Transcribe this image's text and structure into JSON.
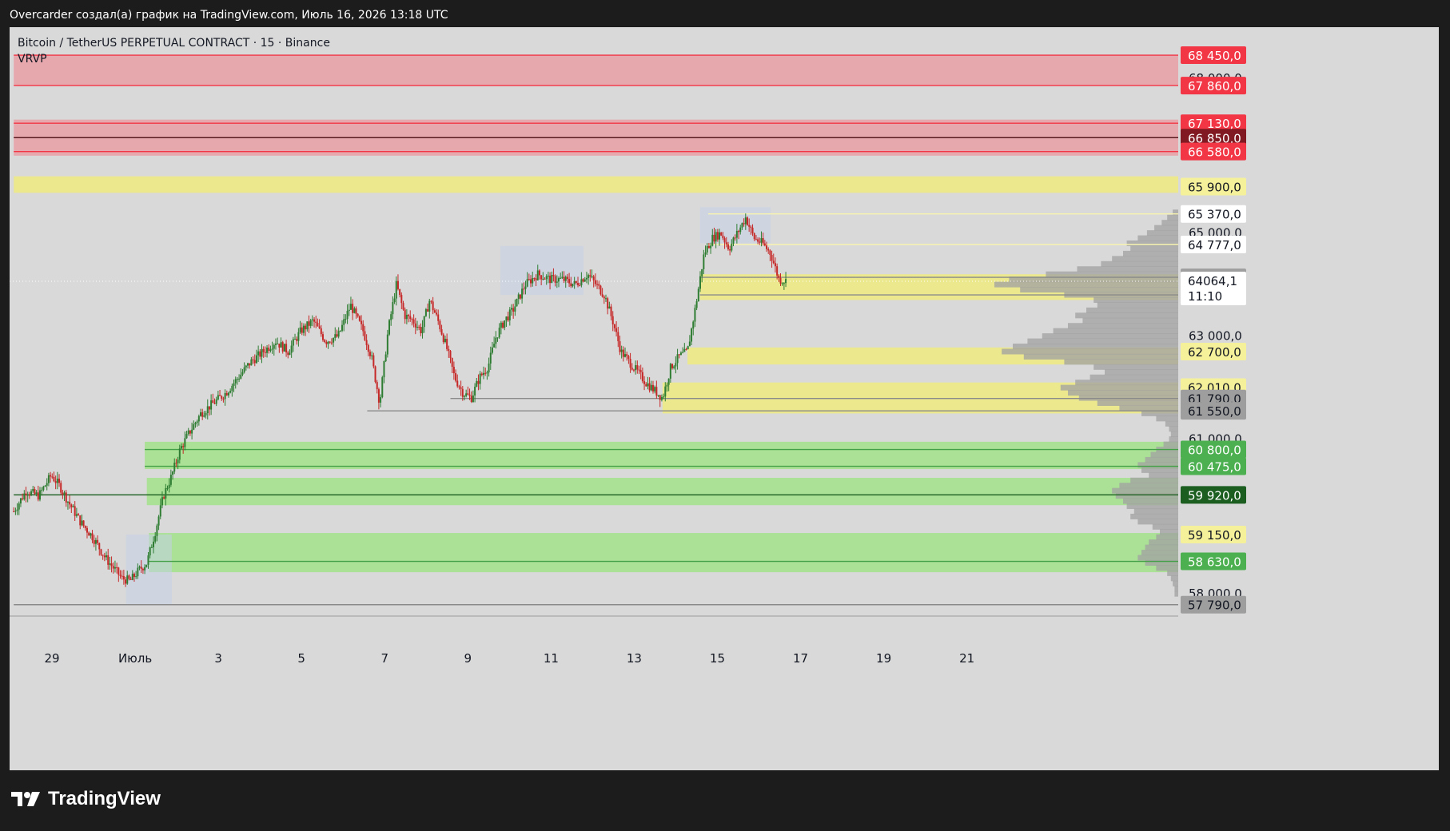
{
  "header": {
    "text": "Overcarder создал(а) график на TradingView.com, Июль 16, 2026 13:18 UTC"
  },
  "brand": {
    "name": "TradingView",
    "icon": "tradingview-logo-icon"
  },
  "chart_data": {
    "type": "candlestick",
    "title": "Bitcoin / TetherUS PERPETUAL CONTRACT · 15 · Binance",
    "indicator": "VRVP",
    "current_price": "64064,1",
    "countdown": "11:10",
    "ylim": [
      57600,
      68900
    ],
    "x_ticks": [
      {
        "label": "29",
        "day": -1
      },
      {
        "label": "Июль",
        "day": 1
      },
      {
        "label": "3",
        "day": 3
      },
      {
        "label": "5",
        "day": 5
      },
      {
        "label": "7",
        "day": 7
      },
      {
        "label": "9",
        "day": 9
      },
      {
        "label": "11",
        "day": 11
      },
      {
        "label": "13",
        "day": 13
      },
      {
        "label": "15",
        "day": 15
      },
      {
        "label": "17",
        "day": 17
      },
      {
        "label": "19",
        "day": 19
      },
      {
        "label": "21",
        "day": 21
      }
    ],
    "y_ticks": [
      {
        "label": "68 000,0",
        "value": 68000
      },
      {
        "label": "65 000,0",
        "value": 65000
      },
      {
        "label": "63 000,0",
        "value": 63000
      },
      {
        "label": "61 000,0",
        "value": 61000
      },
      {
        "label": "58 000,0",
        "value": 58000
      }
    ],
    "price_labels": [
      {
        "label": "68 450,0",
        "value": 68450,
        "bg": "#f23645",
        "fg": "#ffffff"
      },
      {
        "label": "67 860,0",
        "value": 67860,
        "bg": "#f23645",
        "fg": "#ffffff"
      },
      {
        "label": "67 130,0",
        "value": 67130,
        "bg": "#f23645",
        "fg": "#ffffff"
      },
      {
        "label": "66 850,0",
        "value": 66850,
        "bg": "#801922",
        "fg": "#ffffff"
      },
      {
        "label": "66 580,0",
        "value": 66580,
        "bg": "#f23645",
        "fg": "#ffffff"
      },
      {
        "label": "65 900,0",
        "value": 65900,
        "bg": "#f5f19a",
        "fg": "#131722"
      },
      {
        "label": "65 370,0",
        "value": 65370,
        "bg": "#ffffff",
        "fg": "#131722"
      },
      {
        "label": "64 777,0",
        "value": 64777,
        "bg": "#ffffff",
        "fg": "#131722"
      },
      {
        "label": "64 140,0",
        "value": 64140,
        "bg": "#9e9e9e",
        "fg": "#131722"
      },
      {
        "label": "63 800,0",
        "value": 63800,
        "bg": "#9e9e9e",
        "fg": "#131722"
      },
      {
        "label": "62 700,0",
        "value": 62700,
        "bg": "#f5f19a",
        "fg": "#131722"
      },
      {
        "label": "62 010,0",
        "value": 62010,
        "bg": "#f5f19a",
        "fg": "#131722"
      },
      {
        "label": "61 790,0",
        "value": 61790,
        "bg": "#9e9e9e",
        "fg": "#131722"
      },
      {
        "label": "61 550,0",
        "value": 61550,
        "bg": "#9e9e9e",
        "fg": "#131722"
      },
      {
        "label": "60 800,0",
        "value": 60800,
        "bg": "#4caf50",
        "fg": "#ffffff"
      },
      {
        "label": "60 475,0",
        "value": 60475,
        "bg": "#4caf50",
        "fg": "#ffffff"
      },
      {
        "label": "59 920,0",
        "value": 59920,
        "bg": "#1b5e20",
        "fg": "#ffffff"
      },
      {
        "label": "59 150,0",
        "value": 59150,
        "bg": "#f5f19a",
        "fg": "#131722"
      },
      {
        "label": "58 630,0",
        "value": 58630,
        "bg": "#4caf50",
        "fg": "#ffffff"
      },
      {
        "label": "57 790,0",
        "value": 57790,
        "bg": "#9e9e9e",
        "fg": "#131722"
      }
    ],
    "zones": [
      {
        "from": 67860,
        "to": 68450,
        "fill": "#e8a5ab",
        "start_day": -1.9
      },
      {
        "from": 66500,
        "to": 67200,
        "fill": "#e8a5ab",
        "start_day": -1.9
      },
      {
        "from": 65780,
        "to": 66100,
        "fill": "#ece98a",
        "start_day": -1.9
      },
      {
        "from": 63700,
        "to": 64200,
        "fill": "#ece98a",
        "start_day": 14.6
      },
      {
        "from": 62450,
        "to": 62780,
        "fill": "#ece98a",
        "start_day": 14.3
      },
      {
        "from": 61500,
        "to": 62100,
        "fill": "#ece98a",
        "start_day": 13.7
      },
      {
        "from": 60420,
        "to": 60950,
        "fill": "#a8e292",
        "start_day": 1.25
      },
      {
        "from": 59720,
        "to": 60250,
        "fill": "#a8e292",
        "start_day": 1.3
      },
      {
        "from": 58420,
        "to": 59180,
        "fill": "#a8e292",
        "start_day": 1.35
      }
    ],
    "h_lines": [
      {
        "value": 68450,
        "color": "#f23645",
        "start_day": -1.9
      },
      {
        "value": 67860,
        "color": "#f23645",
        "start_day": -1.9
      },
      {
        "value": 67130,
        "color": "#f23645",
        "start_day": -1.9
      },
      {
        "value": 66850,
        "color": "#5a1a1f",
        "start_day": -1.9
      },
      {
        "value": 66580,
        "color": "#f23645",
        "start_day": -1.9
      },
      {
        "value": 65370,
        "color": "#f8f4b0",
        "start_day": 14.8
      },
      {
        "value": 64777,
        "color": "#f8f4b0",
        "start_day": 14.8
      },
      {
        "value": 64140,
        "color": "#8a8a8a",
        "start_day": 14.6
      },
      {
        "value": 63800,
        "color": "#8a8a8a",
        "start_day": 14.6
      },
      {
        "value": 61790,
        "color": "#8a8a8a",
        "start_day": 8.6
      },
      {
        "value": 61550,
        "color": "#8a8a8a",
        "start_day": 6.6
      },
      {
        "value": 60800,
        "color": "#43a047",
        "start_day": 1.25
      },
      {
        "value": 60475,
        "color": "#43a047",
        "start_day": 1.25
      },
      {
        "value": 59920,
        "color": "#1b5e20",
        "start_day": -1.9
      },
      {
        "value": 58630,
        "color": "#43a047",
        "start_day": 1.35
      },
      {
        "value": 57790,
        "color": "#8a8a8a",
        "start_day": -1.9
      }
    ],
    "session_boxes": [
      {
        "start_day": 0.8,
        "end_day": 1.9,
        "low": 57790,
        "high": 59150
      },
      {
        "start_day": 9.8,
        "end_day": 11.8,
        "low": 63800,
        "high": 64750
      },
      {
        "start_day": 14.6,
        "end_day": 16.3,
        "low": 64800,
        "high": 65500
      }
    ],
    "price_path": [
      [
        -1.9,
        59600
      ],
      [
        -1.6,
        60000
      ],
      [
        -1.3,
        59900
      ],
      [
        -1.0,
        60300
      ],
      [
        -0.8,
        60100
      ],
      [
        -0.6,
        59800
      ],
      [
        -0.3,
        59400
      ],
      [
        0.0,
        59100
      ],
      [
        0.3,
        58700
      ],
      [
        0.5,
        58500
      ],
      [
        0.7,
        58300
      ],
      [
        0.9,
        58250
      ],
      [
        1.1,
        58450
      ],
      [
        1.3,
        58600
      ],
      [
        1.5,
        59200
      ],
      [
        1.7,
        59900
      ],
      [
        1.9,
        60300
      ],
      [
        2.1,
        60800
      ],
      [
        2.3,
        61100
      ],
      [
        2.6,
        61500
      ],
      [
        2.9,
        61700
      ],
      [
        3.2,
        61900
      ],
      [
        3.5,
        62200
      ],
      [
        3.8,
        62500
      ],
      [
        4.1,
        62700
      ],
      [
        4.4,
        62900
      ],
      [
        4.7,
        62700
      ],
      [
        5.0,
        63100
      ],
      [
        5.3,
        63300
      ],
      [
        5.6,
        62900
      ],
      [
        5.9,
        63000
      ],
      [
        6.2,
        63600
      ],
      [
        6.5,
        63100
      ],
      [
        6.7,
        62600
      ],
      [
        6.9,
        61700
      ],
      [
        7.1,
        63100
      ],
      [
        7.3,
        64000
      ],
      [
        7.5,
        63400
      ],
      [
        7.7,
        63300
      ],
      [
        7.9,
        63100
      ],
      [
        8.1,
        63700
      ],
      [
        8.3,
        63300
      ],
      [
        8.5,
        62800
      ],
      [
        8.7,
        62200
      ],
      [
        8.9,
        61900
      ],
      [
        9.1,
        61800
      ],
      [
        9.3,
        62200
      ],
      [
        9.5,
        62400
      ],
      [
        9.7,
        63000
      ],
      [
        9.9,
        63300
      ],
      [
        10.1,
        63500
      ],
      [
        10.4,
        64000
      ],
      [
        10.7,
        64200
      ],
      [
        11.0,
        64100
      ],
      [
        11.3,
        64100
      ],
      [
        11.6,
        64000
      ],
      [
        11.9,
        64200
      ],
      [
        12.1,
        64000
      ],
      [
        12.3,
        63800
      ],
      [
        12.5,
        63300
      ],
      [
        12.7,
        62700
      ],
      [
        12.9,
        62500
      ],
      [
        13.1,
        62300
      ],
      [
        13.3,
        62100
      ],
      [
        13.5,
        61950
      ],
      [
        13.7,
        61800
      ],
      [
        13.9,
        62400
      ],
      [
        14.1,
        62600
      ],
      [
        14.3,
        62700
      ],
      [
        14.5,
        63600
      ],
      [
        14.7,
        64600
      ],
      [
        14.9,
        64900
      ],
      [
        15.1,
        65000
      ],
      [
        15.3,
        64700
      ],
      [
        15.5,
        65000
      ],
      [
        15.7,
        65300
      ],
      [
        15.9,
        64900
      ],
      [
        16.1,
        64800
      ],
      [
        16.3,
        64600
      ],
      [
        16.5,
        64100
      ],
      [
        16.7,
        64064
      ]
    ],
    "volume_profile": [
      {
        "value": 65400,
        "len": 0.03
      },
      {
        "value": 65300,
        "len": 0.06
      },
      {
        "value": 65200,
        "len": 0.09
      },
      {
        "value": 65100,
        "len": 0.13
      },
      {
        "value": 65000,
        "len": 0.17
      },
      {
        "value": 64900,
        "len": 0.22
      },
      {
        "value": 64800,
        "len": 0.28
      },
      {
        "value": 64700,
        "len": 0.26
      },
      {
        "value": 64600,
        "len": 0.3
      },
      {
        "value": 64500,
        "len": 0.36
      },
      {
        "value": 64400,
        "len": 0.42
      },
      {
        "value": 64300,
        "len": 0.55
      },
      {
        "value": 64200,
        "len": 0.72
      },
      {
        "value": 64100,
        "len": 0.92
      },
      {
        "value": 64000,
        "len": 1.0
      },
      {
        "value": 63900,
        "len": 0.86
      },
      {
        "value": 63800,
        "len": 0.62
      },
      {
        "value": 63700,
        "len": 0.46
      },
      {
        "value": 63600,
        "len": 0.44
      },
      {
        "value": 63500,
        "len": 0.5
      },
      {
        "value": 63400,
        "len": 0.56
      },
      {
        "value": 63300,
        "len": 0.52
      },
      {
        "value": 63200,
        "len": 0.6
      },
      {
        "value": 63100,
        "len": 0.68
      },
      {
        "value": 63000,
        "len": 0.74
      },
      {
        "value": 62900,
        "len": 0.82
      },
      {
        "value": 62800,
        "len": 0.9
      },
      {
        "value": 62700,
        "len": 0.96
      },
      {
        "value": 62600,
        "len": 0.84
      },
      {
        "value": 62500,
        "len": 0.62
      },
      {
        "value": 62400,
        "len": 0.46
      },
      {
        "value": 62300,
        "len": 0.4
      },
      {
        "value": 62200,
        "len": 0.48
      },
      {
        "value": 62100,
        "len": 0.56
      },
      {
        "value": 62000,
        "len": 0.64
      },
      {
        "value": 61900,
        "len": 0.6
      },
      {
        "value": 61800,
        "len": 0.54
      },
      {
        "value": 61700,
        "len": 0.44
      },
      {
        "value": 61600,
        "len": 0.32
      },
      {
        "value": 61500,
        "len": 0.2
      },
      {
        "value": 61400,
        "len": 0.12
      },
      {
        "value": 61300,
        "len": 0.07
      },
      {
        "value": 61200,
        "len": 0.05
      },
      {
        "value": 61100,
        "len": 0.04
      },
      {
        "value": 61000,
        "len": 0.05
      },
      {
        "value": 60900,
        "len": 0.08
      },
      {
        "value": 60800,
        "len": 0.12
      },
      {
        "value": 60700,
        "len": 0.15
      },
      {
        "value": 60600,
        "len": 0.18
      },
      {
        "value": 60500,
        "len": 0.22
      },
      {
        "value": 60400,
        "len": 0.2
      },
      {
        "value": 60300,
        "len": 0.16
      },
      {
        "value": 60200,
        "len": 0.26
      },
      {
        "value": 60100,
        "len": 0.32
      },
      {
        "value": 60000,
        "len": 0.36
      },
      {
        "value": 59900,
        "len": 0.34
      },
      {
        "value": 59800,
        "len": 0.3
      },
      {
        "value": 59700,
        "len": 0.28
      },
      {
        "value": 59600,
        "len": 0.24
      },
      {
        "value": 59500,
        "len": 0.26
      },
      {
        "value": 59400,
        "len": 0.22
      },
      {
        "value": 59300,
        "len": 0.14
      },
      {
        "value": 59200,
        "len": 0.1
      },
      {
        "value": 59100,
        "len": 0.12
      },
      {
        "value": 59000,
        "len": 0.16
      },
      {
        "value": 58900,
        "len": 0.18
      },
      {
        "value": 58800,
        "len": 0.2
      },
      {
        "value": 58700,
        "len": 0.22
      },
      {
        "value": 58600,
        "len": 0.18
      },
      {
        "value": 58500,
        "len": 0.12
      },
      {
        "value": 58400,
        "len": 0.06
      },
      {
        "value": 58300,
        "len": 0.04
      },
      {
        "value": 58200,
        "len": 0.03
      },
      {
        "value": 58100,
        "len": 0.02
      },
      {
        "value": 58000,
        "len": 0.02
      }
    ],
    "colors": {
      "background": "#d9d9d9",
      "up_candle": "#2e7d32",
      "down_candle": "#c62828",
      "axis_text": "#131722",
      "volume_bar": "#a0a0a0",
      "session_box": "#c5d2e8"
    }
  }
}
